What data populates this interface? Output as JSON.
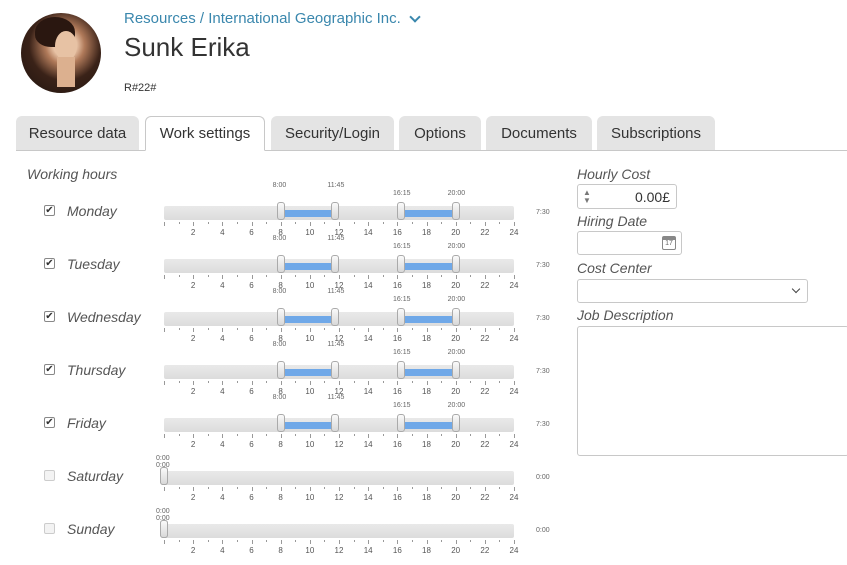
{
  "header": {
    "breadcrumb": "Resources / International Geographic Inc.",
    "title": "Sunk Erika",
    "code": "R#22#"
  },
  "tabs": [
    {
      "label": "Resource data",
      "active": false
    },
    {
      "label": "Work settings",
      "active": true
    },
    {
      "label": "Security/Login",
      "active": false
    },
    {
      "label": "Options",
      "active": false
    },
    {
      "label": "Documents",
      "active": false
    },
    {
      "label": "Subscriptions",
      "active": false
    }
  ],
  "working_hours": {
    "label": "Working hours",
    "axis_ticks": [
      "2",
      "4",
      "6",
      "8",
      "10",
      "12",
      "14",
      "16",
      "18",
      "20",
      "22",
      "24"
    ],
    "days": [
      {
        "name": "Monday",
        "checked": true,
        "ranges": [
          [
            "8:00",
            "11:45"
          ],
          [
            "16:15",
            "20:00"
          ]
        ],
        "total": "7:30"
      },
      {
        "name": "Tuesday",
        "checked": true,
        "ranges": [
          [
            "8:00",
            "11:45"
          ],
          [
            "16:15",
            "20:00"
          ]
        ],
        "total": "7:30"
      },
      {
        "name": "Wednesday",
        "checked": true,
        "ranges": [
          [
            "8:00",
            "11:45"
          ],
          [
            "16:15",
            "20:00"
          ]
        ],
        "total": "7:30"
      },
      {
        "name": "Thursday",
        "checked": true,
        "ranges": [
          [
            "8:00",
            "11:45"
          ],
          [
            "16:15",
            "20:00"
          ]
        ],
        "total": "7:30"
      },
      {
        "name": "Friday",
        "checked": true,
        "ranges": [
          [
            "8:00",
            "11:45"
          ],
          [
            "16:15",
            "20:00"
          ]
        ],
        "total": "7:30"
      },
      {
        "name": "Saturday",
        "checked": false,
        "ranges": [
          [
            "0:00",
            "0:00"
          ]
        ],
        "total": "0:00"
      },
      {
        "name": "Sunday",
        "checked": false,
        "ranges": [
          [
            "0:00",
            "0:00"
          ]
        ],
        "total": "0:00"
      }
    ]
  },
  "side": {
    "hourly_cost_label": "Hourly Cost",
    "hourly_cost_value": "0.00£",
    "hiring_date_label": "Hiring Date",
    "hiring_date_value": "",
    "calendar_day": "17",
    "cost_center_label": "Cost Center",
    "cost_center_value": "",
    "job_description_label": "Job Description",
    "job_description_value": ""
  },
  "colors": {
    "accent": "#3a87ad",
    "range": "#6fa8e8"
  }
}
